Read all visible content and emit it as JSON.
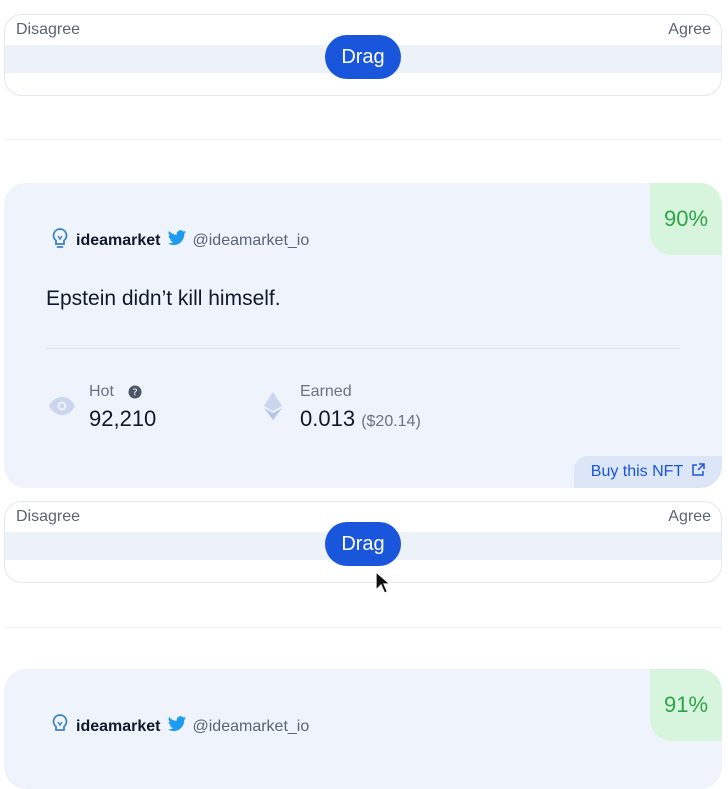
{
  "slider_top": {
    "left_label": "Disagree",
    "right_label": "Agree",
    "button_label": "Drag"
  },
  "card1": {
    "badge": "90%",
    "brand": "ideamarket",
    "handle": "@ideamarket_io",
    "claim": "Epstein didn’t kill himself.",
    "hot_label": "Hot",
    "hot_value": "92,210",
    "earned_label": "Earned",
    "earned_value": "0.013",
    "earned_usd": "($20.14)",
    "buy_label": "Buy this NFT"
  },
  "slider_mid": {
    "left_label": "Disagree",
    "right_label": "Agree",
    "button_label": "Drag"
  },
  "card2": {
    "badge": "91%",
    "brand": "ideamarket",
    "handle": "@ideamarket_io"
  },
  "colors": {
    "accent": "#1a56db",
    "success": "#2fa34a",
    "card_bg": "#eff3fb"
  },
  "icons": [
    "lightbulb-icon",
    "twitter-icon",
    "eye-icon",
    "help-icon",
    "ethereum-icon",
    "external-link-icon",
    "cursor-icon"
  ]
}
